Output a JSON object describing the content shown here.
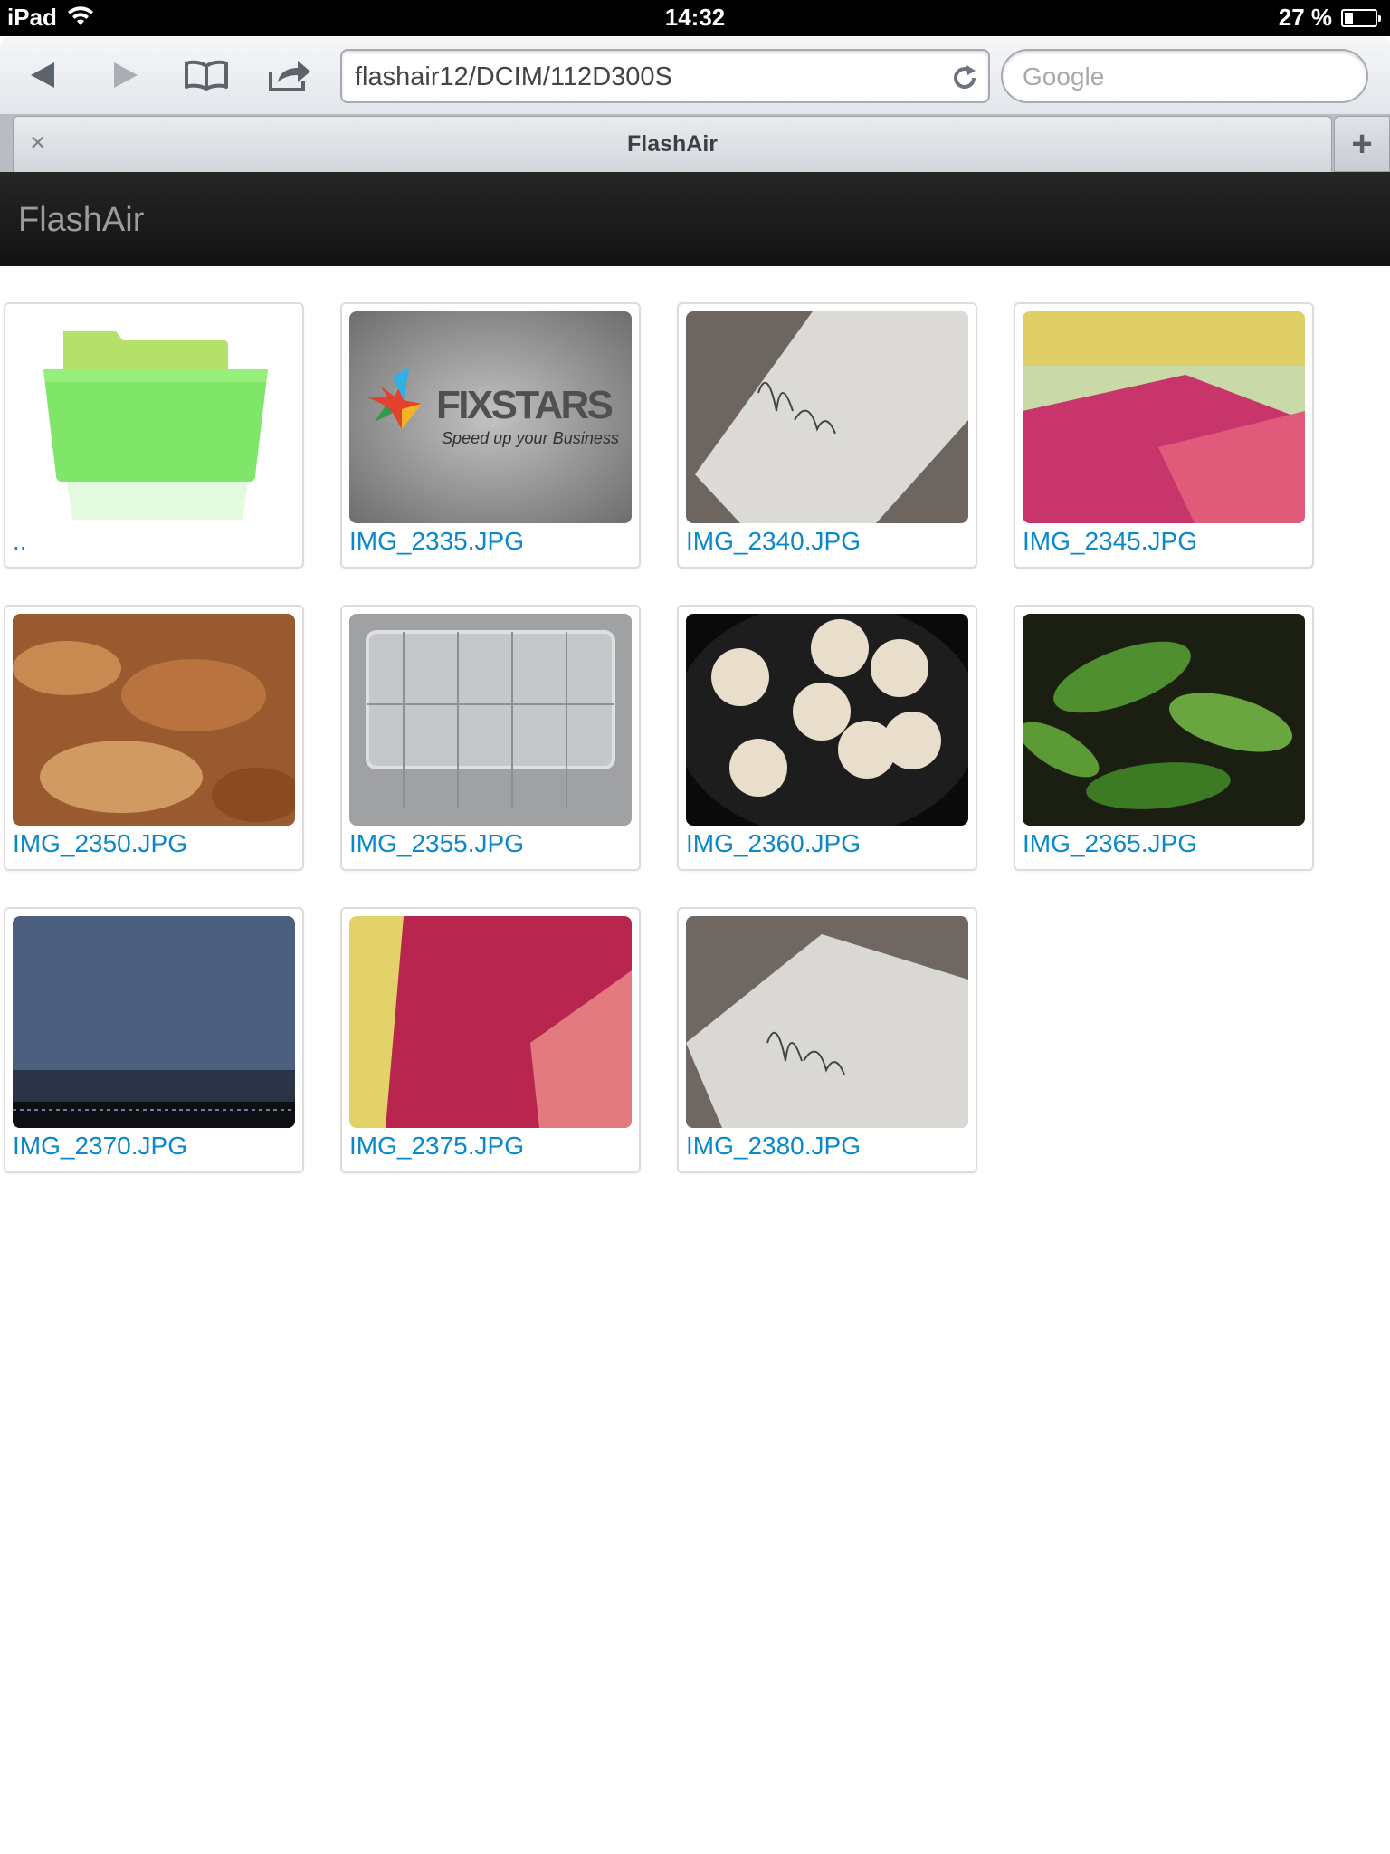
{
  "status_bar": {
    "device": "iPad",
    "time": "14:32",
    "battery": "27 %",
    "battery_level": 0.27
  },
  "browser": {
    "url": "flashair12/DCIM/112D300S",
    "search_placeholder": "Google",
    "tab_title": "FlashAir",
    "tab_close": "×",
    "new_tab": "+"
  },
  "page": {
    "brand": "FlashAir"
  },
  "files": [
    {
      "name": "..",
      "kind": "folder"
    },
    {
      "name": "IMG_2335.JPG",
      "kind": "logo",
      "logo_text": "FIXSTARS",
      "logo_tagline": "Speed up your Business"
    },
    {
      "name": "IMG_2340.JPG",
      "kind": "notebook"
    },
    {
      "name": "IMG_2345.JPG",
      "kind": "fabric-pink"
    },
    {
      "name": "IMG_2350.JPG",
      "kind": "bark"
    },
    {
      "name": "IMG_2355.JPG",
      "kind": "tray"
    },
    {
      "name": "IMG_2360.JPG",
      "kind": "cookies"
    },
    {
      "name": "IMG_2365.JPG",
      "kind": "leaves"
    },
    {
      "name": "IMG_2370.JPG",
      "kind": "denim"
    },
    {
      "name": "IMG_2375.JPG",
      "kind": "fabric-red"
    },
    {
      "name": "IMG_2380.JPG",
      "kind": "notebook2"
    }
  ],
  "colors": {
    "link": "#0b88c9",
    "navbar": "#1b1b1b"
  }
}
